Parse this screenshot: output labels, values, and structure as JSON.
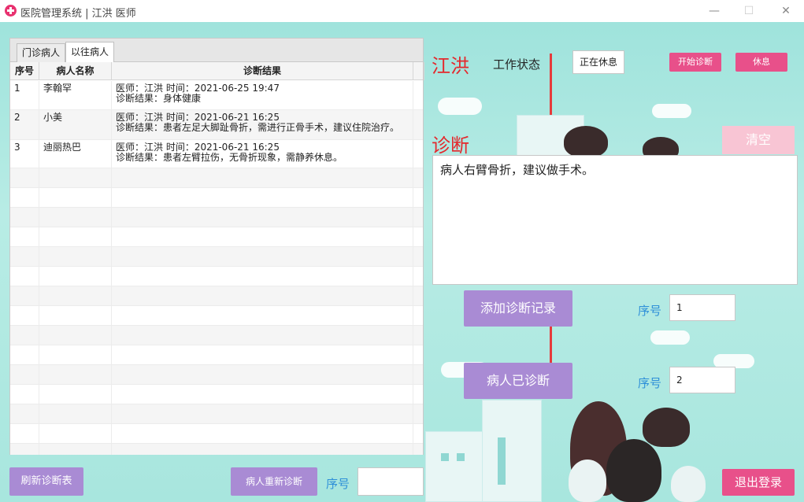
{
  "window": {
    "title": "医院管理系统 | 江洪 医师",
    "controls": {
      "minimize": "—",
      "maximize": "☐",
      "close": "✕"
    }
  },
  "tabs": [
    {
      "label": "门诊病人",
      "active": false
    },
    {
      "label": "以往病人",
      "active": true
    }
  ],
  "table": {
    "headers": [
      "序号",
      "病人名称",
      "诊断结果"
    ],
    "rows": [
      {
        "no": "1",
        "name": "李翰罕",
        "line1": "医师：江洪 时间：2021-06-25 19:47",
        "line2": "诊断结果：身体健康"
      },
      {
        "no": "2",
        "name": "小美",
        "line1": "医师：江洪 时间：2021-06-21 16:25",
        "line2": "诊断结果：患者左足大脚趾骨折，需进行正骨手术，建议住院治疗。"
      },
      {
        "no": "3",
        "name": "迪丽热巴",
        "line1": "医师：江洪 时间：2021-06-21 16:25",
        "line2": "诊断结果：患者左臂拉伤，无骨折现象，需静养休息。"
      }
    ]
  },
  "doctor": {
    "name": "江洪",
    "work_status_label": "工作状态",
    "work_status_value": "正在休息",
    "start_button": "开始诊断",
    "rest_button": "休息"
  },
  "diagnosis": {
    "label": "诊断",
    "clear_button": "清空",
    "text": "病人右臂骨折，建议做手术。"
  },
  "actions": {
    "add_record_button": "添加诊断记录",
    "seq_label": "序号",
    "seq_add_value": "1",
    "diagnosed_button": "病人已诊断",
    "seq_diagnosed_value": "2",
    "refresh_button": "刷新诊断表",
    "rediagnose_button": "病人重新诊断",
    "seq_rediagnose_value": "",
    "logout_button": "退出登录"
  },
  "colors": {
    "accent_red": "#e4282c",
    "pink_button": "#e8508a",
    "purple_button": "#a98bd4",
    "seq_blue": "#2d8fd8",
    "background": "#b8ece5"
  }
}
